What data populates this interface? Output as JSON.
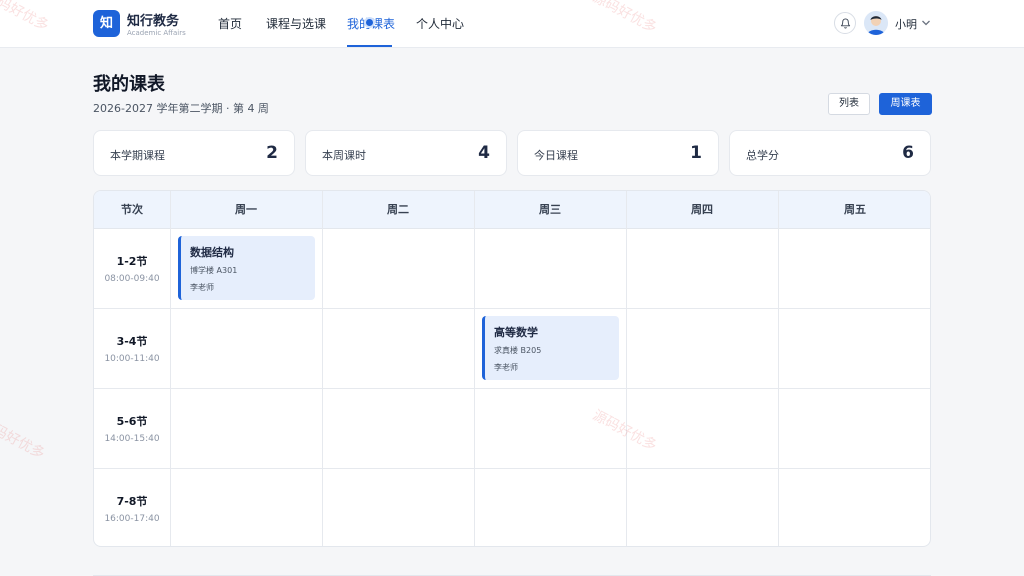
{
  "brand": {
    "logo_char": "知",
    "title": "知行教务",
    "subtitle": "Academic Affairs"
  },
  "nav": {
    "items": [
      {
        "label": "首页"
      },
      {
        "label": "课程与选课"
      },
      {
        "label": "我的课表"
      },
      {
        "label": "个人中心"
      }
    ],
    "active_index": 2
  },
  "user": {
    "name": "小明"
  },
  "page": {
    "title": "我的课表",
    "subtitle": "2026-2027 学年第二学期 · 第 4 周",
    "view_buttons": {
      "list": "列表",
      "week": "周课表"
    }
  },
  "stats": [
    {
      "label": "本学期课程",
      "value": "2"
    },
    {
      "label": "本周课时",
      "value": "4"
    },
    {
      "label": "今日课程",
      "value": "1"
    },
    {
      "label": "总学分",
      "value": "6"
    }
  ],
  "schedule": {
    "period_header": "节次",
    "days": [
      "周一",
      "周二",
      "周三",
      "周四",
      "周五"
    ],
    "periods": [
      {
        "name": "1-2节",
        "time": "08:00-09:40"
      },
      {
        "name": "3-4节",
        "time": "10:00-11:40"
      },
      {
        "name": "5-6节",
        "time": "14:00-15:40"
      },
      {
        "name": "7-8节",
        "time": "16:00-17:40"
      }
    ],
    "courses": [
      {
        "name": "数据结构",
        "room": "博学楼 A301",
        "teacher": "李老师"
      },
      {
        "name": "高等数学",
        "room": "求真楼 B205",
        "teacher": "李老师"
      }
    ]
  },
  "watermark": "源码好优多",
  "colors": {
    "accent": "#1e63d9",
    "course_bg": "#e6eefc",
    "header_bg": "#eef4fd"
  }
}
